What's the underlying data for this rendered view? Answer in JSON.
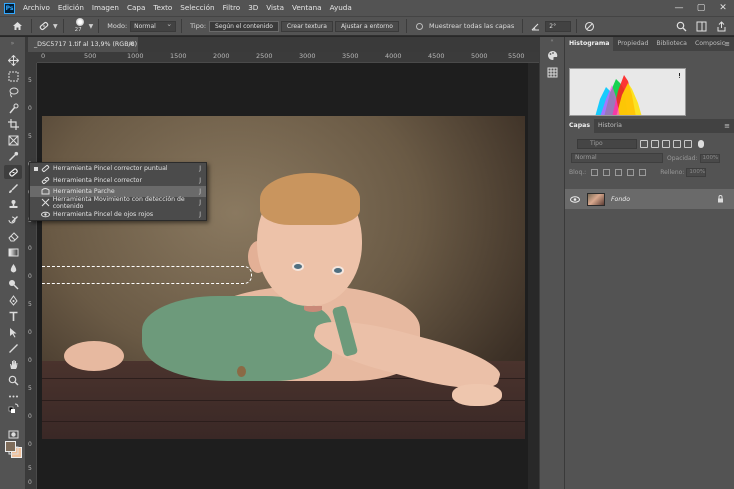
{
  "app": {
    "logo": "Ps",
    "menu": [
      "Archivo",
      "Edición",
      "Imagen",
      "Capa",
      "Texto",
      "Selección",
      "Filtro",
      "3D",
      "Vista",
      "Ventana",
      "Ayuda"
    ],
    "window_controls": {
      "minimize": "—",
      "maximize": "▢",
      "close": "✕"
    }
  },
  "options": {
    "brush_size": "27",
    "mode_label": "Modo:",
    "mode_value": "Normal",
    "type_label": "Tipo:",
    "type_buttons": [
      "Según el contenido",
      "Crear textura",
      "Ajustar a entorno"
    ],
    "sample_all_label": "Muestrear todas las capas",
    "angle_value": "2°"
  },
  "document": {
    "tab_title": "_DSC5717 1.tif al 13,9% (RGB/8)",
    "tab_close": "×"
  },
  "ruler": {
    "h_labels": [
      "0",
      "500",
      "1000",
      "1500",
      "2000",
      "2500",
      "3000",
      "3500",
      "4000",
      "4500",
      "5000",
      "5500"
    ],
    "v_labels": [
      "5",
      "0",
      "5",
      "0",
      "0",
      "5",
      "0",
      "0",
      "5",
      "0",
      "0",
      "5",
      "0",
      "0",
      "5",
      "0"
    ]
  },
  "flyout": {
    "items": [
      {
        "label": "Herramienta Pincel corrector puntual",
        "key": "J",
        "selected": false,
        "active": true
      },
      {
        "label": "Herramienta Pincel corrector",
        "key": "J",
        "selected": false,
        "active": false
      },
      {
        "label": "Herramienta Parche",
        "key": "J",
        "selected": true,
        "active": false
      },
      {
        "label": "Herramienta Movimiento con detección de contenido",
        "key": "J",
        "selected": false,
        "active": false
      },
      {
        "label": "Herramienta Pincel de ojos rojos",
        "key": "J",
        "selected": false,
        "active": false
      }
    ]
  },
  "panels": {
    "top_tabs": [
      "Histograma",
      "Propiedad",
      "Biblioteca",
      "Composic"
    ],
    "layers_tabs": [
      "Capas",
      "Historia"
    ],
    "menu_icon": "≡",
    "search_placeholder": "Tipo",
    "blend_mode": "Normal",
    "opacity_label": "Opacidad:",
    "opacity_value": "100%",
    "lock_label": "Bloq.:",
    "fill_label": "Relleno:",
    "fill_value": "100%",
    "layer_name": "Fondo"
  },
  "colors": {
    "foreground": "#7e6c5a",
    "background": "#f0c09a"
  }
}
